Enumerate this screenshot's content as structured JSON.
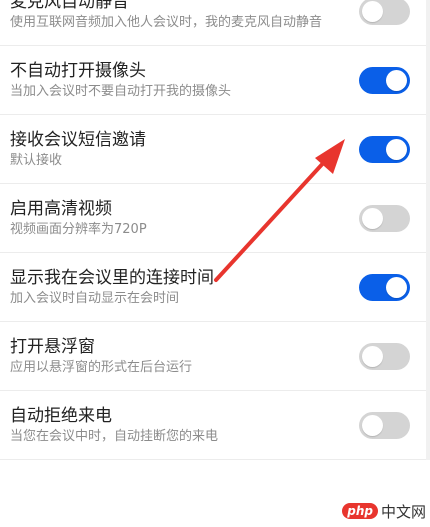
{
  "settings": [
    {
      "title": "麦克风自动静音",
      "desc": "使用互联网音频加入他人会议时，我的麦克风自动静音",
      "enabled": false
    },
    {
      "title": "不自动打开摄像头",
      "desc": "当加入会议时不要自动打开我的摄像头",
      "enabled": true
    },
    {
      "title": "接收会议短信邀请",
      "desc": "默认接收",
      "enabled": true
    },
    {
      "title": "启用高清视频",
      "desc": "视频画面分辨率为720P",
      "enabled": false
    },
    {
      "title": "显示我在会议里的连接时间",
      "desc": "加入会议时自动显示在会时间",
      "enabled": true
    },
    {
      "title": "打开悬浮窗",
      "desc": "应用以悬浮窗的形式在后台运行",
      "enabled": false
    },
    {
      "title": "自动拒绝来电",
      "desc": "当您在会议中时，自动挂断您的来电",
      "enabled": false
    }
  ],
  "watermark": {
    "logo": "php",
    "text": "中文网"
  },
  "colors": {
    "toggle_on": "#0a5fe8",
    "toggle_off": "#d4d4d4",
    "arrow": "#e8352e"
  },
  "icons": {
    "annotation_arrow": "red-arrow-pointing-up-right"
  }
}
